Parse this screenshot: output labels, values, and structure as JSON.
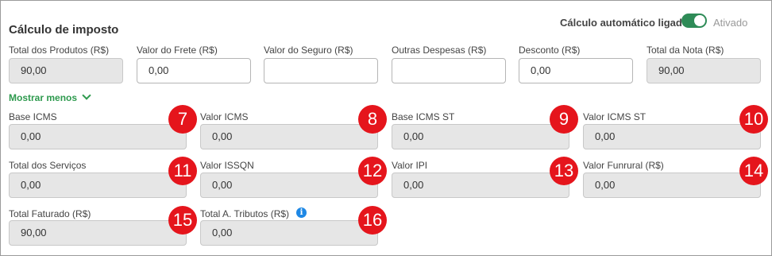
{
  "header": {
    "title": "Cálculo de imposto",
    "auto_label": "Cálculo automático ligado",
    "toggle_state": "Ativado"
  },
  "fields": {
    "total_produtos": {
      "label": "Total dos Produtos (R$)",
      "value": "90,00"
    },
    "valor_frete": {
      "label": "Valor do Frete (R$)",
      "value": "0,00"
    },
    "valor_seguro": {
      "label": "Valor do Seguro (R$)",
      "value": ""
    },
    "outras_despesas": {
      "label": "Outras Despesas (R$)",
      "value": ""
    },
    "desconto": {
      "label": "Desconto (R$)",
      "value": "0,00"
    },
    "total_nota": {
      "label": "Total da Nota (R$)",
      "value": "90,00"
    },
    "base_icms": {
      "label": "Base ICMS",
      "value": "0,00"
    },
    "valor_icms": {
      "label": "Valor ICMS",
      "value": "0,00"
    },
    "base_icms_st": {
      "label": "Base ICMS ST",
      "value": "0,00"
    },
    "valor_icms_st": {
      "label": "Valor ICMS ST",
      "value": "0,00"
    },
    "total_servicos": {
      "label": "Total dos Serviços",
      "value": "0,00"
    },
    "valor_issqn": {
      "label": "Valor ISSQN",
      "value": "0,00"
    },
    "valor_ipi": {
      "label": "Valor IPI",
      "value": "0,00"
    },
    "valor_funrural": {
      "label": "Valor Funrural (R$)",
      "value": "0,00"
    },
    "total_faturado": {
      "label": "Total Faturado (R$)",
      "value": "90,00"
    },
    "total_tributos": {
      "label": "Total A. Tributos (R$)",
      "value": "0,00"
    }
  },
  "toggle_more": {
    "label": "Mostrar menos"
  },
  "badges": [
    "7",
    "8",
    "9",
    "10",
    "11",
    "12",
    "13",
    "14",
    "15",
    "16"
  ],
  "info_icon": "i",
  "colors": {
    "accent_green": "#2e9a4e",
    "badge_red": "#e5151c",
    "info_blue": "#1e88e5"
  }
}
